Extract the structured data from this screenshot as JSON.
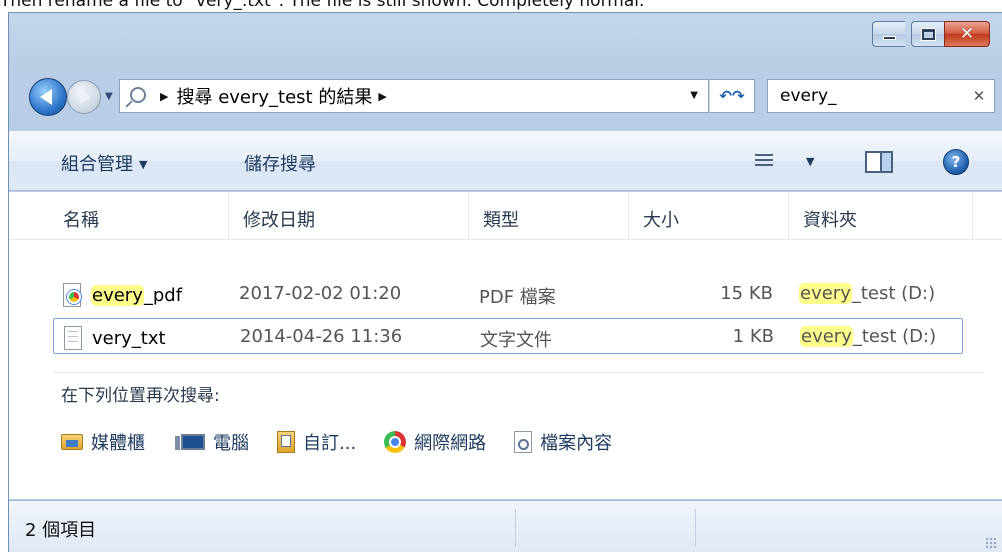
{
  "caption": "Then rename a file to \"very_.txt\". The file is still shown. Completely normal.",
  "window": {
    "min_label": "",
    "close_glyph": "✕"
  },
  "nav": {
    "breadcrumb": "搜尋 every_test 的結果",
    "crumb_sep": "▶",
    "refresh_glyph": "↶↷",
    "search_value": "every_",
    "search_clear": "✕"
  },
  "toolbar": {
    "organize": "組合管理",
    "save_search": "儲存搜尋",
    "help": "?"
  },
  "columns": [
    "名稱",
    "修改日期",
    "類型",
    "大小",
    "資料夾"
  ],
  "files": [
    {
      "name_hl": "every",
      "name_rest": "_pdf",
      "date": "2017-02-02 01:20",
      "type": "PDF 檔案",
      "size": "15 KB",
      "folder_hl": "every",
      "folder_rest": "_test (D:)"
    },
    {
      "name_hl": "",
      "name_rest": "very_txt",
      "date": "2014-04-26 11:36",
      "type": "文字文件",
      "size": "1 KB",
      "folder_hl": "every",
      "folder_rest": "_test (D:)"
    }
  ],
  "search_again": {
    "label": "在下列位置再次搜尋:",
    "locations": [
      "媒體櫃",
      "電腦",
      "自訂...",
      "網際網路",
      "檔案內容"
    ]
  },
  "status": {
    "item_count": "2 個項目"
  },
  "icons": {
    "back": "back-arrow-icon",
    "forward": "forward-arrow-icon",
    "search": "magnifier-icon",
    "help": "help-icon"
  },
  "colors": {
    "highlight": "#ffff8c",
    "accent": "#1f5fae",
    "close": "#c1391c"
  }
}
